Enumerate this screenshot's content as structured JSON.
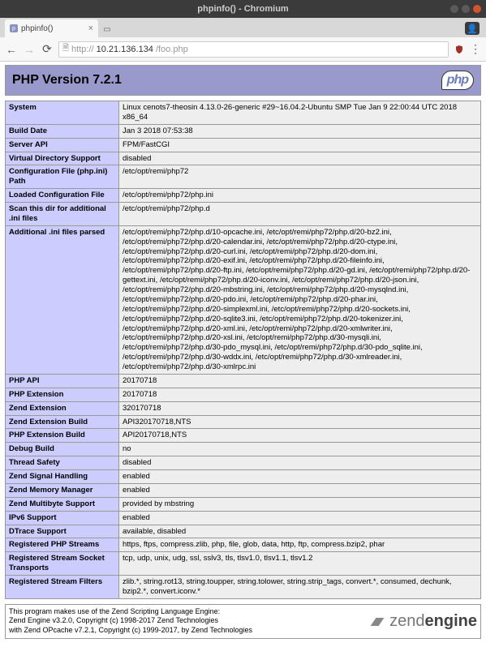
{
  "window": {
    "title": "phpinfo() - Chromium"
  },
  "tab": {
    "title": "phpinfo()"
  },
  "url": {
    "prefix": "http://",
    "host": "10.21.136.134",
    "path": "/foo.php"
  },
  "header": {
    "title": "PHP Version 7.2.1",
    "logo_text": "php"
  },
  "rows": [
    {
      "k": "System",
      "v": "Linux cenots7-theosin 4.13.0-26-generic #29~16.04.2-Ubuntu SMP Tue Jan 9 22:00:44 UTC 2018 x86_64"
    },
    {
      "k": "Build Date",
      "v": "Jan 3 2018 07:53:38"
    },
    {
      "k": "Server API",
      "v": "FPM/FastCGI"
    },
    {
      "k": "Virtual Directory Support",
      "v": "disabled"
    },
    {
      "k": "Configuration File (php.ini) Path",
      "v": "/etc/opt/remi/php72"
    },
    {
      "k": "Loaded Configuration File",
      "v": "/etc/opt/remi/php72/php.ini"
    },
    {
      "k": "Scan this dir for additional .ini files",
      "v": "/etc/opt/remi/php72/php.d"
    },
    {
      "k": "Additional .ini files parsed",
      "v": "/etc/opt/remi/php72/php.d/10-opcache.ini, /etc/opt/remi/php72/php.d/20-bz2.ini, /etc/opt/remi/php72/php.d/20-calendar.ini, /etc/opt/remi/php72/php.d/20-ctype.ini, /etc/opt/remi/php72/php.d/20-curl.ini, /etc/opt/remi/php72/php.d/20-dom.ini, /etc/opt/remi/php72/php.d/20-exif.ini, /etc/opt/remi/php72/php.d/20-fileinfo.ini, /etc/opt/remi/php72/php.d/20-ftp.ini, /etc/opt/remi/php72/php.d/20-gd.ini, /etc/opt/remi/php72/php.d/20-gettext.ini, /etc/opt/remi/php72/php.d/20-iconv.ini, /etc/opt/remi/php72/php.d/20-json.ini, /etc/opt/remi/php72/php.d/20-mbstring.ini, /etc/opt/remi/php72/php.d/20-mysqlnd.ini, /etc/opt/remi/php72/php.d/20-pdo.ini, /etc/opt/remi/php72/php.d/20-phar.ini, /etc/opt/remi/php72/php.d/20-simplexml.ini, /etc/opt/remi/php72/php.d/20-sockets.ini, /etc/opt/remi/php72/php.d/20-sqlite3.ini, /etc/opt/remi/php72/php.d/20-tokenizer.ini, /etc/opt/remi/php72/php.d/20-xml.ini, /etc/opt/remi/php72/php.d/20-xmlwriter.ini, /etc/opt/remi/php72/php.d/20-xsl.ini, /etc/opt/remi/php72/php.d/30-mysqli.ini, /etc/opt/remi/php72/php.d/30-pdo_mysql.ini, /etc/opt/remi/php72/php.d/30-pdo_sqlite.ini, /etc/opt/remi/php72/php.d/30-wddx.ini, /etc/opt/remi/php72/php.d/30-xmlreader.ini, /etc/opt/remi/php72/php.d/30-xmlrpc.ini"
    },
    {
      "k": "PHP API",
      "v": "20170718"
    },
    {
      "k": "PHP Extension",
      "v": "20170718"
    },
    {
      "k": "Zend Extension",
      "v": "320170718"
    },
    {
      "k": "Zend Extension Build",
      "v": "API320170718,NTS"
    },
    {
      "k": "PHP Extension Build",
      "v": "API20170718,NTS"
    },
    {
      "k": "Debug Build",
      "v": "no"
    },
    {
      "k": "Thread Safety",
      "v": "disabled"
    },
    {
      "k": "Zend Signal Handling",
      "v": "enabled"
    },
    {
      "k": "Zend Memory Manager",
      "v": "enabled"
    },
    {
      "k": "Zend Multibyte Support",
      "v": "provided by mbstring"
    },
    {
      "k": "IPv6 Support",
      "v": "enabled"
    },
    {
      "k": "DTrace Support",
      "v": "available, disabled"
    },
    {
      "k": "Registered PHP Streams",
      "v": "https, ftps, compress.zlib, php, file, glob, data, http, ftp, compress.bzip2, phar"
    },
    {
      "k": "Registered Stream Socket Transports",
      "v": "tcp, udp, unix, udg, ssl, sslv3, tls, tlsv1.0, tlsv1.1, tlsv1.2"
    },
    {
      "k": "Registered Stream Filters",
      "v": "zlib.*, string.rot13, string.toupper, string.tolower, string.strip_tags, convert.*, consumed, dechunk, bzip2.*, convert.iconv.*"
    }
  ],
  "footer": {
    "line1": "This program makes use of the Zend Scripting Language Engine:",
    "line2": "Zend Engine v3.2.0, Copyright (c) 1998-2017 Zend Technologies",
    "line3": "    with Zend OPcache v7.2.1, Copyright (c) 1999-2017, by Zend Technologies",
    "logo_light": "zend",
    "logo_bold": "engine"
  }
}
